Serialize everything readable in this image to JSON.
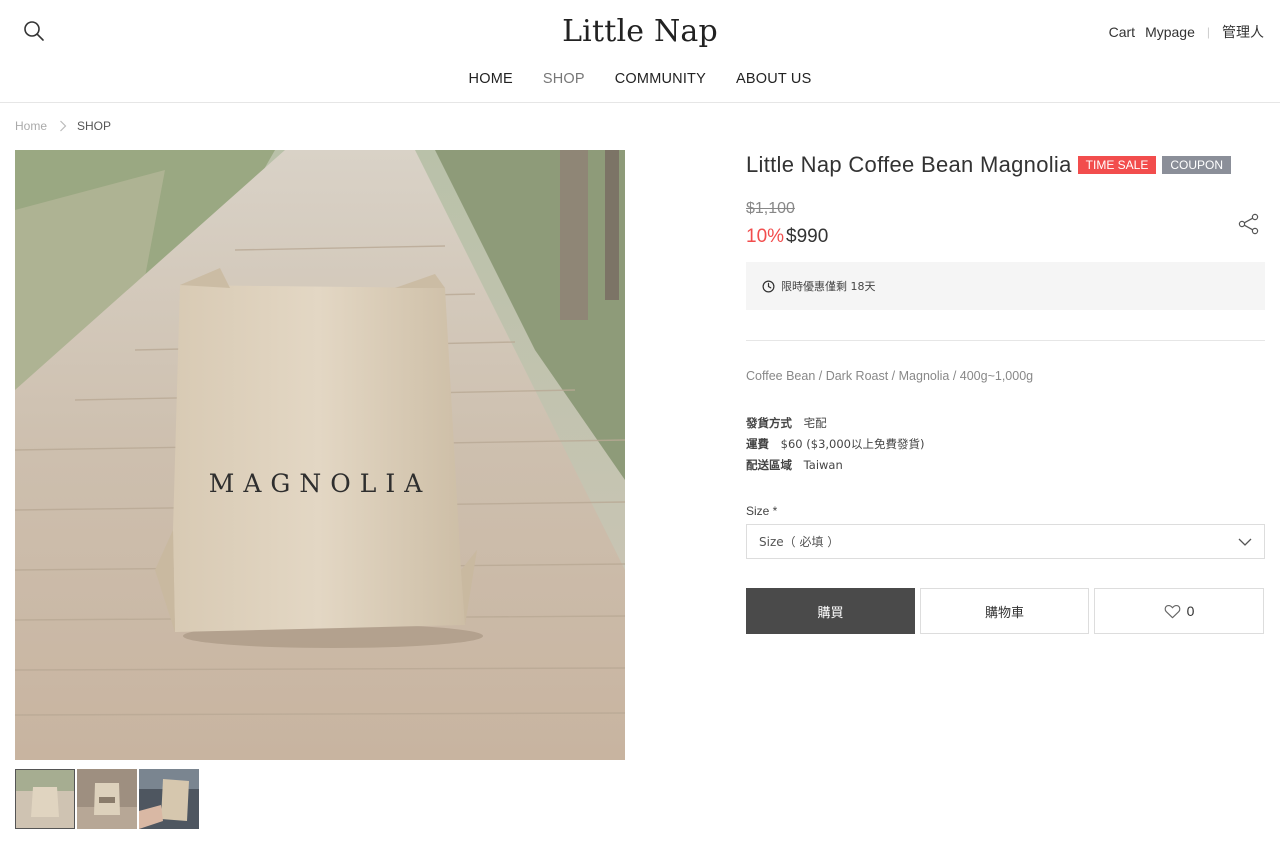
{
  "header": {
    "logo": "Little Nap",
    "links": {
      "cart": "Cart",
      "mypage": "Mypage",
      "separator": "|",
      "admin": "管理人"
    },
    "nav": [
      {
        "label": "HOME"
      },
      {
        "label": "SHOP"
      },
      {
        "label": "COMMUNITY"
      },
      {
        "label": "ABOUT US"
      }
    ]
  },
  "breadcrumb": {
    "home": "Home",
    "current": "SHOP"
  },
  "product": {
    "image_text": "MAGNOLIA",
    "title": "Little Nap Coffee Bean Magnolia",
    "badges": {
      "time_sale": "TIME SALE",
      "coupon": "COUPON"
    },
    "original_price": "$1,100",
    "discount": "10%",
    "price": "$990",
    "notice": "限時優惠僅剩 18天",
    "summary": "Coffee Bean / Dark Roast / Magnolia / 400g~1,000g",
    "shipping": [
      {
        "key": "發貨方式",
        "value": "宅配"
      },
      {
        "key": "運費",
        "value": "$60 ($3,000以上免費發貨)"
      },
      {
        "key": "配送區域",
        "value": "Taiwan"
      }
    ],
    "size_label": "Size *",
    "size_placeholder": "Size（ 必填 ）",
    "buttons": {
      "buy": "購買",
      "cart": "購物車",
      "likes": "0"
    }
  },
  "icons": {
    "search": "search-icon",
    "share": "share-icon",
    "clock": "clock-icon",
    "chevron": "chevron-down-icon",
    "heart": "heart-icon"
  },
  "colors": {
    "sale": "#f24d4d",
    "coupon": "#8b8f99",
    "buy_button": "#4a4a4a"
  }
}
